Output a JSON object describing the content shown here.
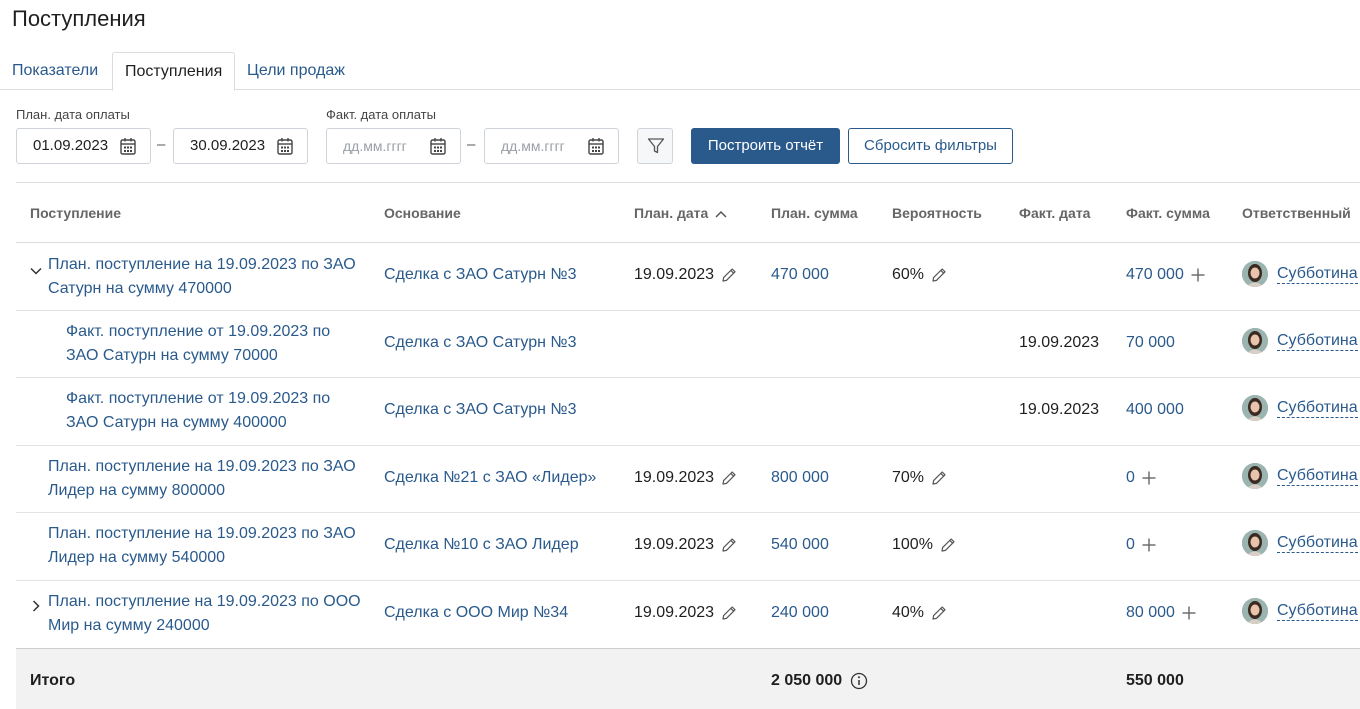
{
  "page": {
    "title": "Поступления"
  },
  "tabs": [
    {
      "label": "Показатели",
      "active": false
    },
    {
      "label": "Поступления",
      "active": true
    },
    {
      "label": "Цели продаж",
      "active": false
    }
  ],
  "filters": {
    "plan_date_label": "План. дата оплаты",
    "plan_from": "01.09.2023",
    "plan_to": "30.09.2023",
    "fact_date_label": "Факт. дата оплаты",
    "fact_from_placeholder": "дд.мм.гггг",
    "fact_to_placeholder": "дд.мм.гггг",
    "dash": "–",
    "build_label": "Построить отчёт",
    "reset_label": "Сбросить фильтры"
  },
  "table": {
    "columns": {
      "receipt": "Поступление",
      "basis": "Основание",
      "plan_date": "План. дата",
      "plan_sum": "План. сумма",
      "probability": "Вероятность",
      "fact_date": "Факт. дата",
      "fact_sum": "Факт. сумма",
      "responsible": "Ответственный"
    },
    "rows": [
      {
        "name": "План. поступление на 19.09.2023 по ЗАО Сатурн на сумму 470000",
        "basis": "Сделка с ЗАО Сатурн №3",
        "plan_date": "19.09.2023",
        "plan_sum": "470 000",
        "probability": "60%",
        "fact_date": "",
        "fact_sum": "470 000",
        "responsible": "Субботина"
      },
      {
        "name": "Факт. поступление от 19.09.2023 по ЗАО Сатурн на сумму 70000",
        "basis": "Сделка с ЗАО Сатурн №3",
        "plan_date": "",
        "plan_sum": "",
        "probability": "",
        "fact_date": "19.09.2023",
        "fact_sum": "70 000",
        "responsible": "Субботина"
      },
      {
        "name": "Факт. поступление от 19.09.2023 по ЗАО Сатурн на сумму 400000",
        "basis": "Сделка с ЗАО Сатурн №3",
        "plan_date": "",
        "plan_sum": "",
        "probability": "",
        "fact_date": "19.09.2023",
        "fact_sum": "400 000",
        "responsible": "Субботина"
      },
      {
        "name": "План. поступление на 19.09.2023 по ЗАО Лидер на сумму 800000",
        "basis": "Сделка №21 с ЗАО «Лидер»",
        "plan_date": "19.09.2023",
        "plan_sum": "800 000",
        "probability": "70%",
        "fact_date": "",
        "fact_sum": "0",
        "responsible": "Субботина"
      },
      {
        "name": "План. поступление на 19.09.2023 по ЗАО Лидер на сумму 540000",
        "basis": "Сделка №10 с ЗАО Лидер",
        "plan_date": "19.09.2023",
        "plan_sum": "540 000",
        "probability": "100%",
        "fact_date": "",
        "fact_sum": "0",
        "responsible": "Субботина"
      },
      {
        "name": "План. поступление на 19.09.2023 по ООО Мир на сумму 240000",
        "basis": "Сделка с ООО Мир №34",
        "plan_date": "19.09.2023",
        "plan_sum": "240 000",
        "probability": "40%",
        "fact_date": "",
        "fact_sum": "80 000",
        "responsible": "Субботина"
      }
    ],
    "total": {
      "label": "Итого",
      "plan_sum": "2 050 000",
      "fact_sum": "550 000"
    }
  },
  "icons": {
    "calendar": "calendar-icon",
    "filter": "funnel-icon",
    "edit": "pencil-icon",
    "add": "plus-icon",
    "expand": "chevron-icon",
    "info": "info-icon",
    "sort": "chevron-up-icon"
  },
  "colors": {
    "accent": "#2a5a8c",
    "total_bg": "#f2f2f2"
  }
}
